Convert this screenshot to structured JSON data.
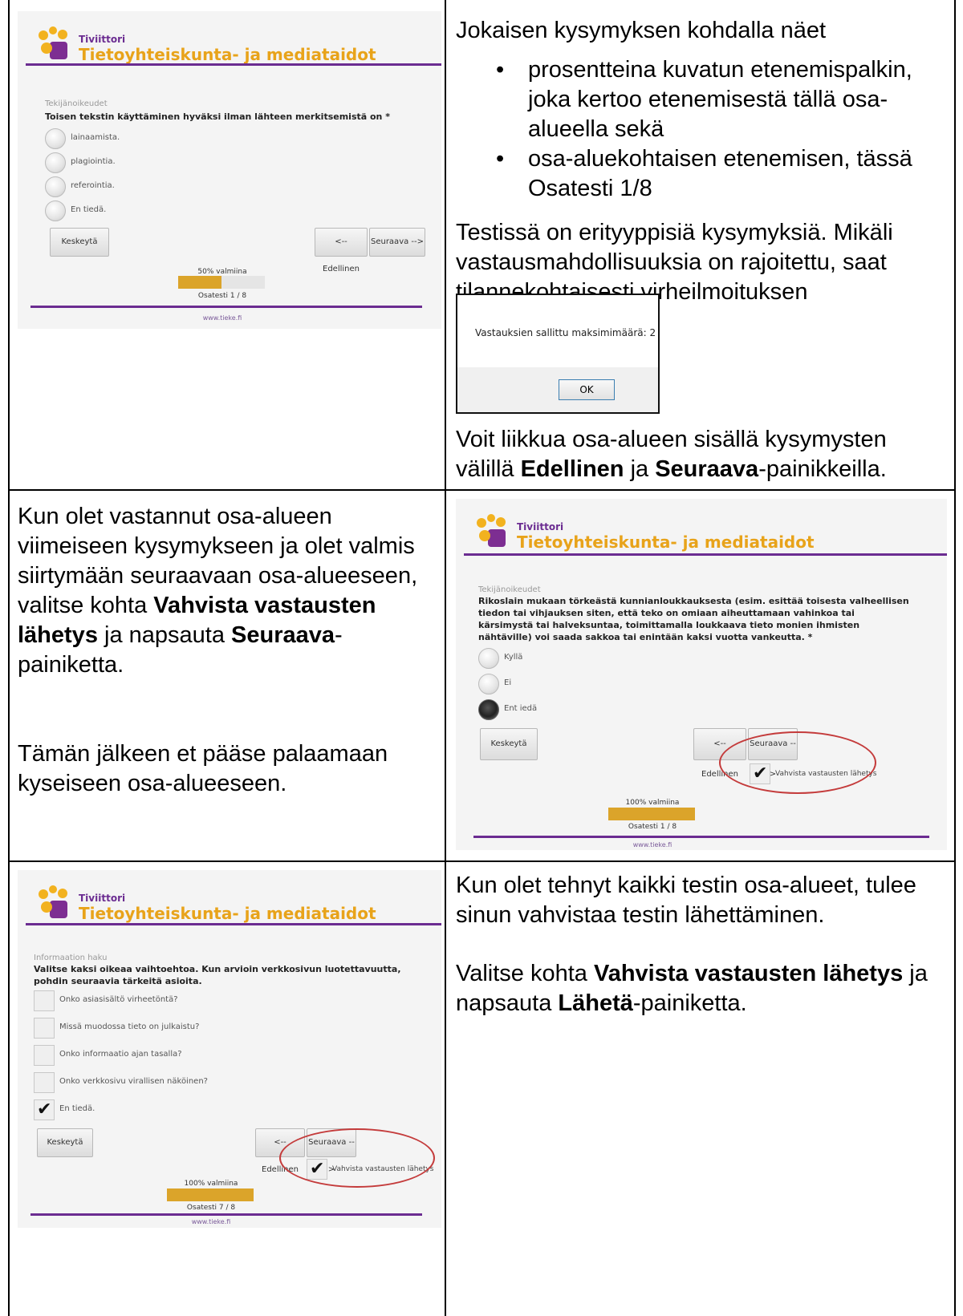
{
  "cells": {
    "r1_right": {
      "intro": "Jokaisen kysymyksen kohdalla näet",
      "bullets": [
        "prosentteina kuvatun etenemispalkin, joka kertoo etenemisestä tällä osa-alueella sekä",
        "osa-aluekohtaisen etenemisen, tässä Osatesti 1/8"
      ],
      "types_text": "Testissä on erityyppisiä kysymyksiä. Mikäli vastausmahdollisuuksia on rajoitettu, saat tilannekohtaisesti virheilmoituksen",
      "dialog": {
        "message": "Vastauksien sallittu maksimimäärä: 2",
        "ok": "OK"
      },
      "nav_pre": "Voit liikkua osa-alueen sisällä kysymysten välillä ",
      "nav_bold1": "Edellinen",
      "nav_mid": " ja ",
      "nav_bold2": "Seuraava",
      "nav_post": "-painikkeilla."
    },
    "r2_left": {
      "p1_pre": "Kun olet vastannut osa-alueen viimeiseen kysymykseen ja olet valmis siirtymään seuraavaan osa-alueeseen, valitse kohta ",
      "p1_bold1": "Vahvista vastausten lähetys",
      "p1_mid": " ja napsauta ",
      "p1_bold2": "Seuraava",
      "p1_post": "-painiketta.",
      "p2": "Tämän jälkeen et pääse palaamaan kyseiseen osa-alueeseen."
    },
    "r3_right": {
      "p1": "Kun olet tehnyt kaikki testin osa-alueet, tulee sinun vahvistaa testin lähettäminen.",
      "p2_pre": "Valitse kohta ",
      "p2_bold1": "Vahvista vastausten lähetys",
      "p2_mid": " ja napsauta ",
      "p2_bold2": "Lähetä",
      "p2_post": "-painiketta."
    }
  },
  "shots": {
    "common": {
      "brand_small": "Tiviittori",
      "brand_big": "Tietoyhteiskunta- ja mediataidot",
      "btn_suspend": "Keskeytä",
      "btn_prev": "<-- Edellinen",
      "btn_next": "Seuraava -->",
      "confirm_label": "Vahvista vastausten lähetys",
      "footer": "www.tieke.fi"
    },
    "s1": {
      "section": "Tekijänoikeudet",
      "question": "Toisen tekstin käyttäminen hyväksi ilman lähteen merkitsemistä on *",
      "options": [
        "lainaamista.",
        "plagiointia.",
        "referointia.",
        "En tiedä."
      ],
      "progress_label": "50% valmiina",
      "progress": 0.5,
      "pager": "Osatesti 1 / 8"
    },
    "s2": {
      "section": "Tekijänoikeudet",
      "question": "Rikoslain mukaan törkeästä kunnianloukkauksesta (esim. esittää toisesta valheellisen tiedon tai vihjauksen siten, että teko on omiaan aiheuttamaan vahinkoa tai kärsimystä tai halveksuntaa, toimittamalla loukkaava tieto monien ihmisten nähtäville) voi saada sakkoa tai enintään kaksi vuotta vankeutta. *",
      "options": [
        "Kyllä",
        "Ei",
        "Ent iedä"
      ],
      "selected": 2,
      "progress_label": "100% valmiina",
      "progress": 1.0,
      "pager": "Osatesti 1 / 8"
    },
    "s3": {
      "section": "Informaation haku",
      "question": "Valitse kaksi oikeaa vaihtoehtoa. Kun arvioin verkkosivun luotettavuutta, pohdin seuraavia tärkeitä asioita.",
      "options": [
        "Onko asiasisältö virheetöntä?",
        "Missä muodossa tieto on julkaistu?",
        "Onko informaatio ajan tasalla?",
        "Onko verkkosivu virallisen näköinen?",
        "En tiedä."
      ],
      "checked": [
        4
      ],
      "progress_label": "100% valmiina",
      "progress": 1.0,
      "pager": "Osatesti 7 / 8"
    }
  }
}
